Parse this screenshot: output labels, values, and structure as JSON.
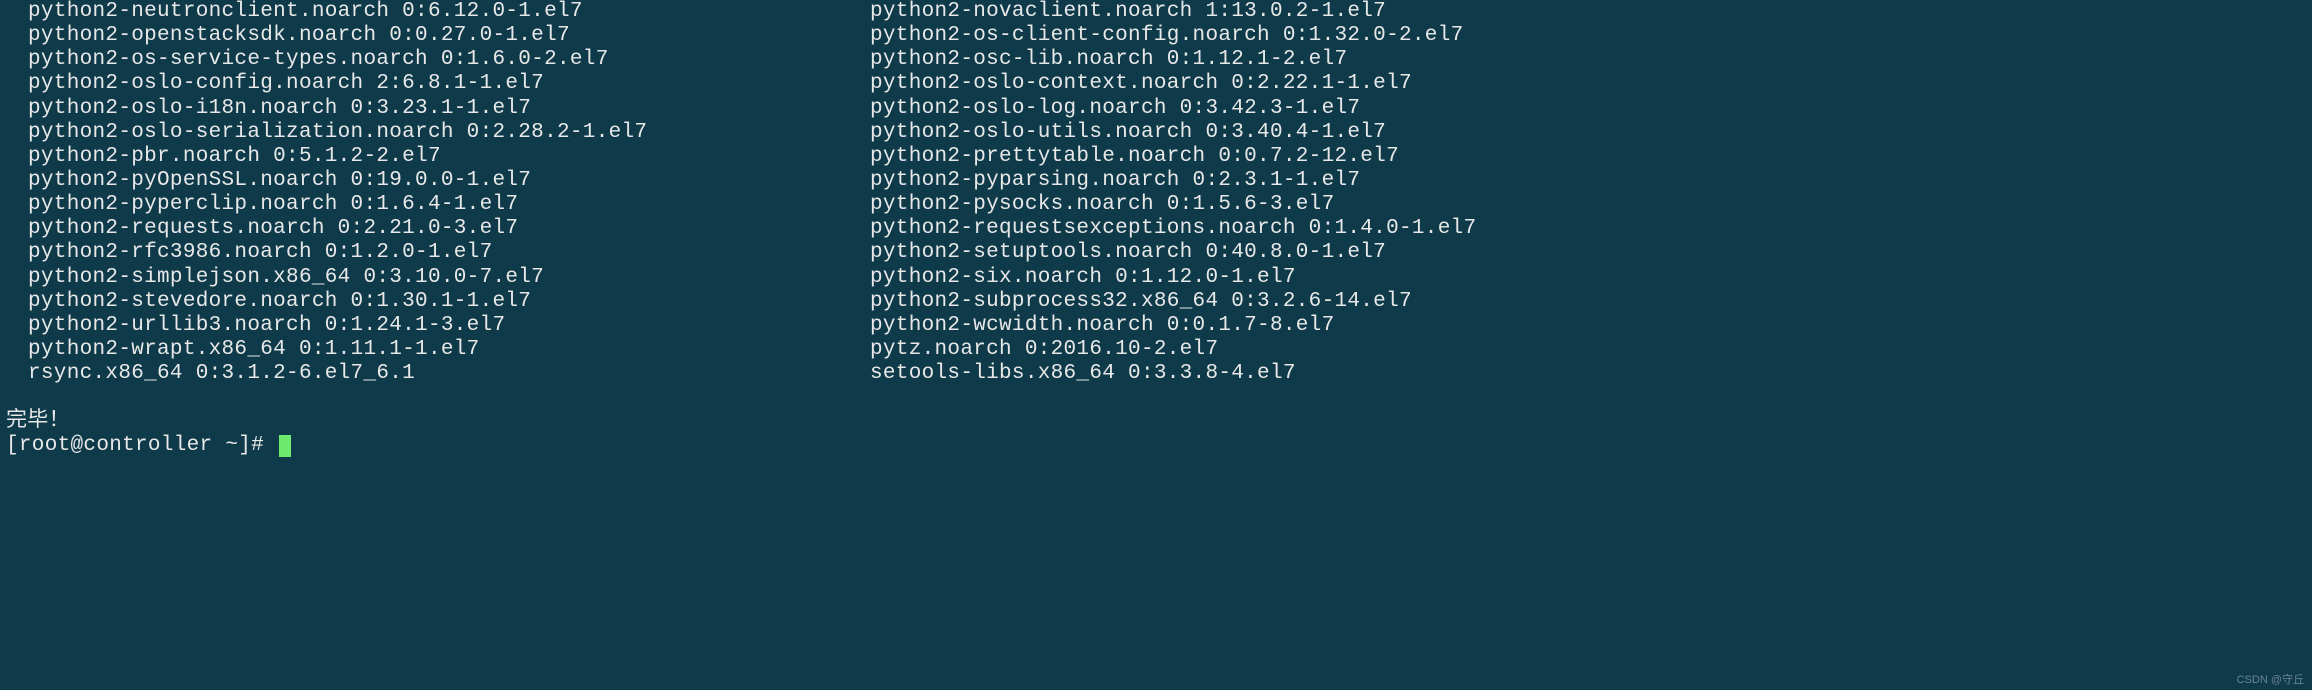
{
  "packages_left": [
    "python2-neutronclient.noarch 0:6.12.0-1.el7",
    "python2-openstacksdk.noarch 0:0.27.0-1.el7",
    "python2-os-service-types.noarch 0:1.6.0-2.el7",
    "python2-oslo-config.noarch 2:6.8.1-1.el7",
    "python2-oslo-i18n.noarch 0:3.23.1-1.el7",
    "python2-oslo-serialization.noarch 0:2.28.2-1.el7",
    "python2-pbr.noarch 0:5.1.2-2.el7",
    "python2-pyOpenSSL.noarch 0:19.0.0-1.el7",
    "python2-pyperclip.noarch 0:1.6.4-1.el7",
    "python2-requests.noarch 0:2.21.0-3.el7",
    "python2-rfc3986.noarch 0:1.2.0-1.el7",
    "python2-simplejson.x86_64 0:3.10.0-7.el7",
    "python2-stevedore.noarch 0:1.30.1-1.el7",
    "python2-urllib3.noarch 0:1.24.1-3.el7",
    "python2-wrapt.x86_64 0:1.11.1-1.el7",
    "rsync.x86_64 0:3.1.2-6.el7_6.1"
  ],
  "packages_right": [
    "python2-novaclient.noarch 1:13.0.2-1.el7",
    "python2-os-client-config.noarch 0:1.32.0-2.el7",
    "python2-osc-lib.noarch 0:1.12.1-2.el7",
    "python2-oslo-context.noarch 0:2.22.1-1.el7",
    "python2-oslo-log.noarch 0:3.42.3-1.el7",
    "python2-oslo-utils.noarch 0:3.40.4-1.el7",
    "python2-prettytable.noarch 0:0.7.2-12.el7",
    "python2-pyparsing.noarch 0:2.3.1-1.el7",
    "python2-pysocks.noarch 0:1.5.6-3.el7",
    "python2-requestsexceptions.noarch 0:1.4.0-1.el7",
    "python2-setuptools.noarch 0:40.8.0-1.el7",
    "python2-six.noarch 0:1.12.0-1.el7",
    "python2-subprocess32.x86_64 0:3.2.6-14.el7",
    "python2-wcwidth.noarch 0:0.1.7-8.el7",
    "pytz.noarch 0:2016.10-2.el7",
    "setools-libs.x86_64 0:3.3.8-4.el7"
  ],
  "complete_text": "完毕！",
  "prompt": "[root@controller ~]# ",
  "watermark": "CSDN @守丘"
}
